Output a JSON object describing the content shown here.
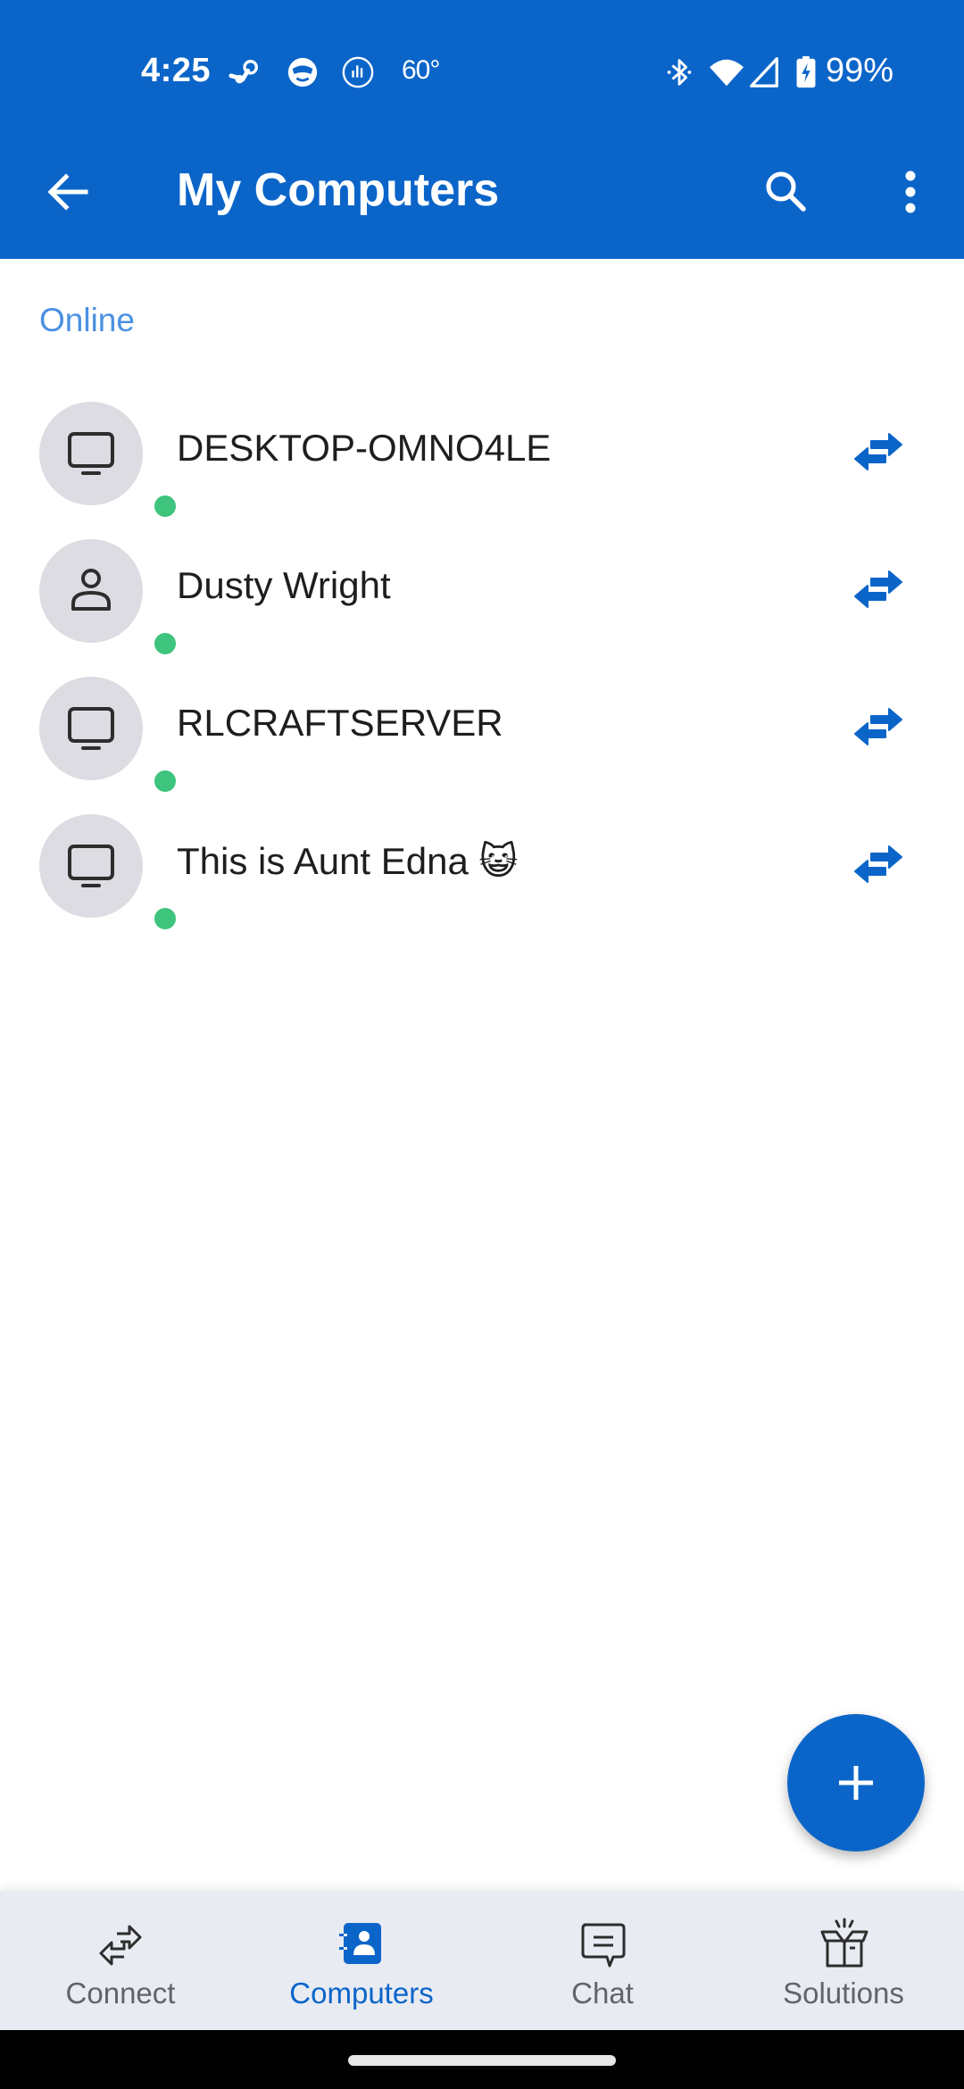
{
  "status_bar": {
    "time": "4:25",
    "notification_icons": [
      "steam-icon",
      "vpn-mascot-icon",
      "sound-bars-icon"
    ],
    "temperature": "60°",
    "system_icons": [
      "bluetooth-icon",
      "wifi-icon",
      "cellular-signal-icon",
      "battery-charging-icon"
    ],
    "battery_percent": "99%"
  },
  "toolbar": {
    "title": "My Computers",
    "back_icon": "arrow-left-icon",
    "search_icon": "search-icon",
    "more_icon": "more-vertical-icon"
  },
  "section": {
    "label": "Online"
  },
  "computers": [
    {
      "name": "DESKTOP-OMNO4LE",
      "type": "computer",
      "status": "online"
    },
    {
      "name": "Dusty Wright",
      "type": "contact",
      "status": "online"
    },
    {
      "name": "RLCRAFTSERVER",
      "type": "computer",
      "status": "online"
    },
    {
      "name": "This is Aunt Edna 😺",
      "type": "computer",
      "status": "online"
    }
  ],
  "fab": {
    "icon": "plus-icon",
    "action": "add"
  },
  "bottom_nav": {
    "items": [
      {
        "label": "Connect",
        "icon": "connect-arrows-icon",
        "active": false
      },
      {
        "label": "Computers",
        "icon": "contact-book-icon",
        "active": true
      },
      {
        "label": "Chat",
        "icon": "chat-bubble-icon",
        "active": false
      },
      {
        "label": "Solutions",
        "icon": "open-box-icon",
        "active": false
      }
    ]
  },
  "colors": {
    "brand": "#0b65c9",
    "section_label": "#4a90e2",
    "online": "#3ec47c",
    "avatar_bg": "#dcdce2",
    "nav_bg": "#e8ebf2"
  }
}
